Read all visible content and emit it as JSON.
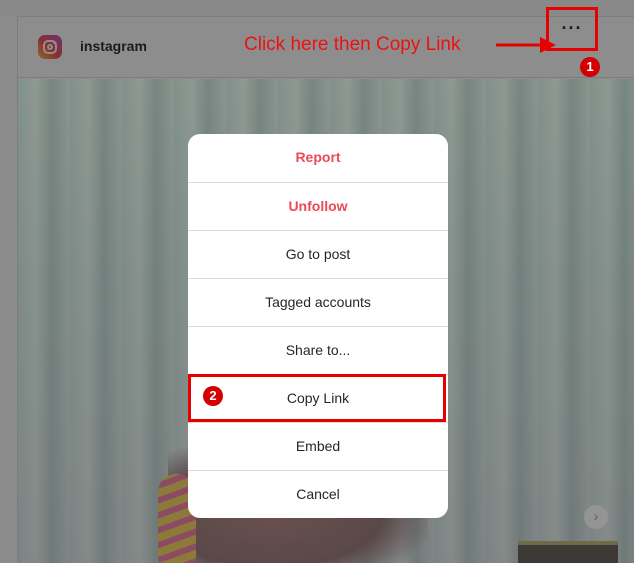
{
  "post": {
    "username": "instagram",
    "more_icon_text": "···"
  },
  "annotation": {
    "text": "Click here then Copy Link",
    "step1": "1",
    "step2": "2",
    "color": "#e60000"
  },
  "menu": {
    "items": [
      {
        "label": "Report"
      },
      {
        "label": "Unfollow"
      },
      {
        "label": "Go to post"
      },
      {
        "label": "Tagged accounts"
      },
      {
        "label": "Share to..."
      },
      {
        "label": "Copy Link"
      },
      {
        "label": "Embed"
      },
      {
        "label": "Cancel"
      }
    ]
  },
  "carousel": {
    "next_icon": "chevron-right-icon",
    "next_glyph": "›"
  },
  "colors": {
    "danger": "#ed4956",
    "annotation_red": "#e60000"
  }
}
